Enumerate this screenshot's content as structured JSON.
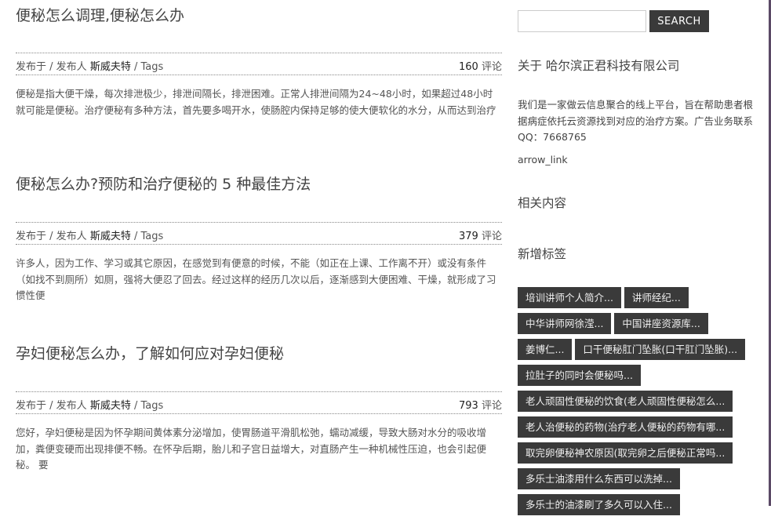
{
  "posts": [
    {
      "title": "便秘怎么调理,便秘怎么办",
      "meta_published": "发布于",
      "meta_sep1": " / ",
      "meta_by": "发布人",
      "meta_author": "斯威夫特",
      "meta_sep2": " / ",
      "meta_tags": "Tags",
      "comment_count": "160",
      "comment_label": "评论",
      "excerpt": "便秘是指大便干燥，每次排泄极少，排泄间隔长，排泄困难。正常人排泄间隔为24~48小时，如果超过48小时就可能是便秘。治疗便秘有多种方法，首先要多喝开水，使肠腔内保持足够的使大便软化的水分，从而达到治疗"
    },
    {
      "title": "便秘怎么办?预防和治疗便秘的 5 种最佳方法",
      "meta_published": "发布于",
      "meta_sep1": " / ",
      "meta_by": "发布人",
      "meta_author": "斯威夫特",
      "meta_sep2": " / ",
      "meta_tags": "Tags",
      "comment_count": "379",
      "comment_label": "评论",
      "excerpt": "许多人，因为工作、学习或其它原因，在感觉到有便意的时候，不能（如正在上课、工作离不开）或没有条件（如找不到厕所）如厕，强将大便忍了回去。经过这样的经历几次以后，逐渐感到大便困难、干燥，就形成了习惯性便"
    },
    {
      "title": "孕妇便秘怎么办，了解如何应对孕妇便秘",
      "meta_published": "发布于",
      "meta_sep1": " / ",
      "meta_by": "发布人",
      "meta_author": "斯威夫特",
      "meta_sep2": " / ",
      "meta_tags": "Tags",
      "comment_count": "793",
      "comment_label": "评论",
      "excerpt": "您好，孕妇便秘是因为怀孕期间黄体素分泌增加，使胃肠道平滑肌松弛，蠕动减缓，导致大肠对水分的吸收增加，粪便变硬而出现排便不畅。在怀孕后期，胎儿和子宫日益增大，对直肠产生一种机械性压迫，也会引起便秘。 要"
    }
  ],
  "sidebar": {
    "search_value": "",
    "search_button": "SEARCH",
    "about_title": "关于 哈尔滨正君科技有限公司",
    "about_text": "我们是一家做云信息聚合的线上平台，旨在帮助患者根据病症依托云资源找到对应的治疗方案。广告业务联系QQ：7668765",
    "arrow_link": "arrow_link",
    "related_title": "相关内容",
    "tags_title": "新增标签",
    "tags": [
      "培训讲师个人简介...",
      "讲师经纪...",
      "中华讲师网徐滢...",
      "中国讲座资源库...",
      "姜博仁...",
      "口干便秘肛门坠胀(口干肛门坠胀)...",
      "拉肚子的同时会便秘吗...",
      "老人顽固性便秘的饮食(老人顽固性便秘怎么...",
      "老人治便秘的药物(治疗老人便秘的药物有哪...",
      "取完卵便秘神农原因(取完卵之后便秘正常吗...",
      "多乐士油漆用什么东西可以洗掉...",
      "多乐士的油漆刷了多久可以入住..."
    ]
  },
  "colors": {
    "accent_dark": "#3a3a3a",
    "right_border": "#5b4a66"
  }
}
